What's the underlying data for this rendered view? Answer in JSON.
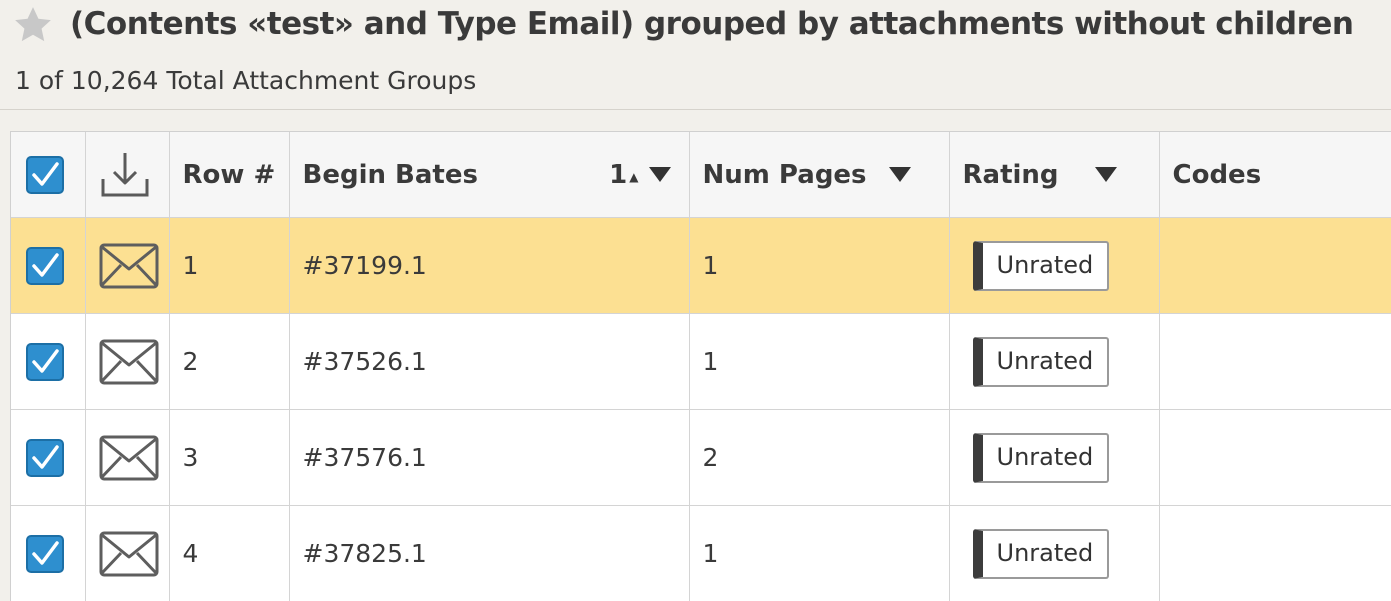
{
  "header": {
    "title": "(Contents «test» and Type Email) grouped by attachments without children",
    "subtitle": "1 of 10,264 Total Attachment Groups"
  },
  "columns": {
    "row_num": "Row #",
    "begin_bates": "Begin Bates",
    "sort_order": "1",
    "num_pages": "Num Pages",
    "rating": "Rating",
    "codes": "Codes"
  },
  "rows": [
    {
      "row": "1",
      "bates": "#37199.1",
      "pages": "1",
      "rating": "Unrated",
      "codes": "",
      "checked": true,
      "selected": true
    },
    {
      "row": "2",
      "bates": "#37526.1",
      "pages": "1",
      "rating": "Unrated",
      "codes": "",
      "checked": true,
      "selected": false
    },
    {
      "row": "3",
      "bates": "#37576.1",
      "pages": "2",
      "rating": "Unrated",
      "codes": "",
      "checked": true,
      "selected": false
    },
    {
      "row": "4",
      "bates": "#37825.1",
      "pages": "1",
      "rating": "Unrated",
      "codes": "",
      "checked": true,
      "selected": false
    }
  ],
  "icons": {
    "favorite": "star-icon",
    "download": "download-icon",
    "row_type": "email-icon",
    "checkbox": "checkbox-checked-icon"
  },
  "colors": {
    "accent": "#2e8fcf",
    "selected_row": "#fce092",
    "header_bg": "#f2f0eb"
  }
}
